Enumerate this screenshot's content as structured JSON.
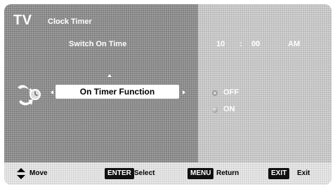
{
  "header": {
    "logo": "TV",
    "title": "Clock Timer"
  },
  "switch_on": {
    "label": "Switch On Time",
    "hour": "10",
    "separator": ":",
    "minute": "00",
    "ampm": "AM"
  },
  "function": {
    "label": "On Timer Function"
  },
  "options": [
    {
      "label": "OFF",
      "selected": false
    },
    {
      "label": "ON",
      "selected": true
    }
  ],
  "footer": {
    "move_label": "Move",
    "enter_key": "ENTER",
    "select_label": "Select",
    "menu_key": "MENU",
    "return_label": "Return",
    "exit_key": "EXIT",
    "exit_label": "Exit"
  },
  "icons": {
    "clock": "clock-timer-icon",
    "move": "up-down-arrow-icon",
    "left": "left-arrow-icon",
    "right": "right-arrow-icon",
    "up": "up-arrow-icon",
    "radio_off": "radio-unselected-icon",
    "radio_on": "radio-selected-icon"
  },
  "colors": {
    "left_panel": "#8a8a8a",
    "right_panel": "#c9c9c9",
    "footer": "#e6e6e6",
    "highlight": "#ffffff",
    "key_bg": "#111111"
  }
}
